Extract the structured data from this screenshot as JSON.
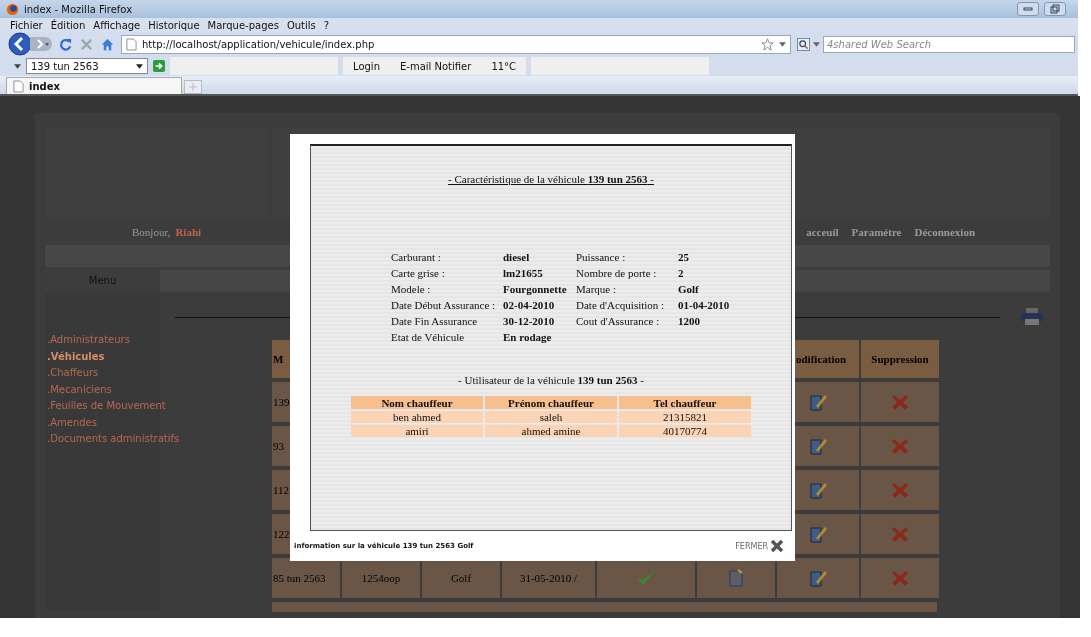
{
  "browser": {
    "title": "index - Mozilla Firefox",
    "menu": [
      "Fichier",
      "Édition",
      "Affichage",
      "Historique",
      "Marque-pages",
      "Outils",
      "?"
    ],
    "url": "http://localhost/application/vehicule/index.php",
    "search": {
      "placeholder": "4shared Web Search"
    },
    "toolbar": {
      "field_value": "139 tun 2563",
      "items": [
        "Login",
        "E-mail Notifier",
        "11°C"
      ]
    },
    "tabs": [
      {
        "label": "index",
        "selected": true
      }
    ]
  },
  "page": {
    "greeting": "Bonjour,",
    "user": "Riahi",
    "nav_links": [
      "acceuil",
      "Paramétre",
      "Déconnexion"
    ],
    "menu_title": "Menu",
    "sidebar": [
      {
        "label": ".Administrateurs",
        "selected": false
      },
      {
        "label": ".Véhicules",
        "selected": true
      },
      {
        "label": ".Chaffeurs",
        "selected": false
      },
      {
        "label": ".Mecaniciens",
        "selected": false
      },
      {
        "label": ".Feuilles de Mouvement",
        "selected": false
      },
      {
        "label": ".Amendes",
        "selected": false
      },
      {
        "label": ".Documents administratifs",
        "selected": false
      }
    ],
    "table": {
      "header": {
        "column_1": "M",
        "column_7": "odification",
        "column_8": "Suppression"
      },
      "rows": [
        {
          "column_1": "139"
        },
        {
          "column_1": "93"
        },
        {
          "column_1": "112"
        },
        {
          "column_1": "122"
        },
        {
          "column_1": "85 tun 2563",
          "column_2": "1254oop",
          "column_3": "Golf",
          "column_4": "31-05-2010 /",
          "validated": true
        }
      ]
    }
  },
  "modal": {
    "title": "- Caractéristique de la véhicule **139 tun 2563** -",
    "specs": [
      {
        "left": {
          "label": "Carburant :",
          "value": "diesel"
        },
        "right": {
          "label": "Puissance :",
          "value": "25"
        }
      },
      {
        "left": {
          "label": "Carte grise :",
          "value": "lm21655"
        },
        "right": {
          "label": "Nombre de porte :",
          "value": "2"
        }
      },
      {
        "left": {
          "label": "Modele :",
          "value": "Fourgonnette"
        },
        "right": {
          "label": "Marque :",
          "value": "Golf"
        }
      },
      {
        "left": {
          "label": "Date Début Assurance :",
          "value": "02-04-2010"
        },
        "right": {
          "label": "Date d'Acquisition :",
          "value": "01-04-2010"
        }
      },
      {
        "left": {
          "label": "Date Fin Assurance",
          "value": "30-12-2010"
        },
        "right": {
          "label": "Cout d'Assurance :",
          "value": "1200"
        }
      },
      {
        "left": {
          "label": "Etat de Véhicule",
          "value": "En rodage"
        }
      }
    ],
    "users_title": "- Utilisateur de la véhicule **139 tun 2563** -",
    "drivers": {
      "columns": [
        "Nom chauffeur",
        "Prénom chauffeur",
        "Tel chauffeur"
      ],
      "rows": [
        [
          "ben ahmed",
          "saleh",
          "21315821"
        ],
        [
          "amiri",
          "ahmed amine",
          "40170774"
        ]
      ]
    },
    "footer": "information sur la véhicule 139 tun 2563 Golf",
    "close": "FERMER"
  }
}
